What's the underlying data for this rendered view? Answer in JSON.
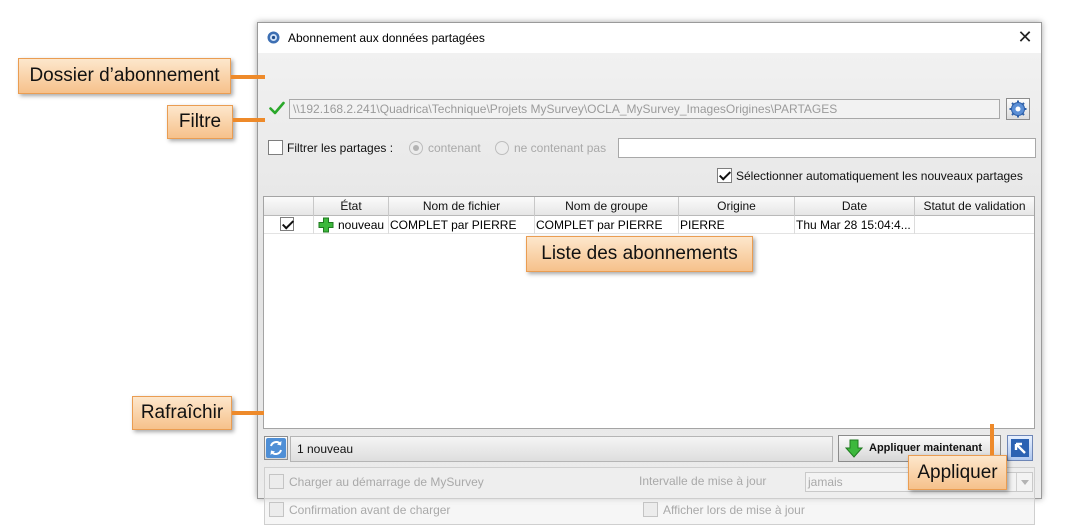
{
  "window": {
    "title": "Abonnement aux données partagées",
    "close_glyph": "✕"
  },
  "folder": {
    "path": "\\\\192.168.2.241\\Quadrica\\Technique\\Projets MySurvey\\OCLA_MySurvey_ImagesOrigines\\PARTAGES",
    "status_icon": "check-icon",
    "settings_icon": "gear-icon"
  },
  "filter": {
    "label": "Filtrer les partages :",
    "checked": false,
    "option_contains": "contenant",
    "option_not_contains": "ne contenant pas",
    "selected_option": "contenant",
    "value": ""
  },
  "auto_select": {
    "label": "Sélectionner automatiquement les nouveaux partages",
    "checked": true
  },
  "table": {
    "columns": [
      "",
      "État",
      "Nom de fichier",
      "Nom de groupe",
      "Origine",
      "Date",
      "Statut de validation"
    ],
    "rows": [
      {
        "checked": true,
        "state_icon": "plus-icon",
        "state": "nouveau",
        "file_name": "COMPLET par PIERRE",
        "group_name": "COMPLET par PIERRE",
        "origin": "PIERRE",
        "date": "Thu Mar 28 15:04:4...",
        "validation": ""
      }
    ]
  },
  "bottom": {
    "refresh_icon": "refresh-icon",
    "status": "1 nouveau",
    "apply_label": "Appliquer maintenant",
    "apply_icon": "download-arrow-icon",
    "exit_icon": "exit-arrow-icon"
  },
  "options": {
    "load_at_startup": "Charger au démarrage de MySurvey",
    "confirm_before_load": "Confirmation avant de charger",
    "interval_label": "Intervalle de mise à jour",
    "interval_value": "jamais",
    "show_on_update": "Afficher lors de mise à jour"
  },
  "callouts": {
    "folder": "Dossier d’abonnement",
    "filter": "Filtre",
    "list": "Liste des abonnements",
    "refresh": "Rafraîchir",
    "apply": "Appliquer"
  },
  "colors": {
    "callout_border": "#ea9d52",
    "callout_arrow": "#ee8a2a",
    "ok_green": "#2aa82a"
  }
}
